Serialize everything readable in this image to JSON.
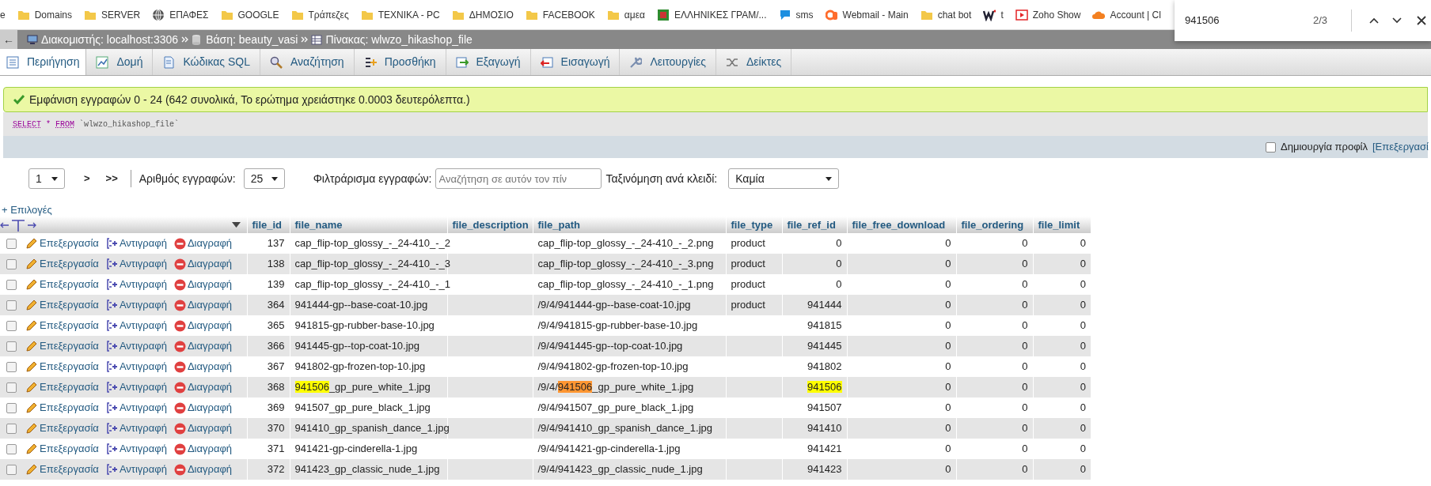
{
  "bookmarks": [
    {
      "label": "e",
      "kind": "page"
    },
    {
      "label": "Domains",
      "kind": "folder"
    },
    {
      "label": "SERVER",
      "kind": "folder"
    },
    {
      "label": "ΕΠΑΦΕΣ",
      "kind": "site"
    },
    {
      "label": "GOOGLE",
      "kind": "folder"
    },
    {
      "label": "Τράπεζες",
      "kind": "folder"
    },
    {
      "label": "ΤΕΧΝΙΚΑ - PC",
      "kind": "folder"
    },
    {
      "label": "ΔΗΜΟΣΙΟ",
      "kind": "folder"
    },
    {
      "label": "FACEBOOK",
      "kind": "folder"
    },
    {
      "label": "αμεα",
      "kind": "folder"
    },
    {
      "label": "ΕΛΛΗΝΙΚΕΣ ΓΡΑΜ/...",
      "kind": "site"
    },
    {
      "label": "sms",
      "kind": "site"
    },
    {
      "label": "Webmail - Main",
      "kind": "site"
    },
    {
      "label": "chat bot",
      "kind": "folder"
    },
    {
      "label": "t",
      "kind": "site"
    },
    {
      "label": "Zoho Show",
      "kind": "site"
    },
    {
      "label": "Account | Cl",
      "kind": "site"
    }
  ],
  "find_bar": {
    "query": "941506",
    "count": "2/3"
  },
  "back_button": "←",
  "breadcrumb": [
    {
      "label": "Διακομιστής: localhost:3306"
    },
    {
      "label": "Βάση: beauty_vasi"
    },
    {
      "label": "Πίνακας: wlwzo_hikashop_file"
    }
  ],
  "tabs": [
    {
      "label": "Περιήγηση",
      "selected": true
    },
    {
      "label": "Δομή",
      "selected": false
    },
    {
      "label": "Κώδικας SQL",
      "selected": false
    },
    {
      "label": "Αναζήτηση",
      "selected": false
    },
    {
      "label": "Προσθήκη",
      "selected": false
    },
    {
      "label": "Εξαγωγή",
      "selected": false
    },
    {
      "label": "Εισαγωγή",
      "selected": false
    },
    {
      "label": "Λειτουργίες",
      "selected": false
    },
    {
      "label": "Δείκτες",
      "selected": false
    }
  ],
  "message": "Εμφάνιση εγγραφών 0 - 24 (642 συνολικά, Το ερώτημα χρειάστηκε 0.0003 δευτερόλεπτα.)",
  "sql": [
    {
      "text": "SELECT",
      "kind": "keyword"
    },
    {
      "text": "*",
      "kind": "operator"
    },
    {
      "text": "FROM",
      "kind": "keyword"
    },
    {
      "text": "`wlwzo_hikashop_file`",
      "kind": "identifier"
    }
  ],
  "profiling": {
    "label": "Δημιουργία προφίλ",
    "checked": false,
    "link": "[Επεξεργασί"
  },
  "navigation": {
    "page": "1",
    "next": ">",
    "last": ">>",
    "rows_label": "Αριθμός εγγραφών:",
    "rows_value": "25",
    "filter_label": "Φιλτράρισμα εγγραφών:",
    "filter_placeholder": "Αναζήτηση σε αυτόν τον πίν",
    "sort_label": "Ταξινόμηση ανά κλειδί:",
    "sort_value": "Καμία"
  },
  "options_link": "+ Επιλογές",
  "table": {
    "columns": [
      "file_id",
      "file_name",
      "file_description",
      "file_path",
      "file_type",
      "file_ref_id",
      "file_free_download",
      "file_ordering",
      "file_limit"
    ],
    "rows": [
      {
        "checked": false,
        "edit": "Επεξεργασία",
        "copy": "Αντιγραφή",
        "delete": "Διαγραφή",
        "file_id": "137",
        "file_name": "cap_flip-top_glossy_-_24-410_-_2",
        "file_path": "cap_flip-top_glossy_-_24-410_-_2.png",
        "file_type": "product",
        "file_ref_id": "0",
        "file_free_download": "0",
        "file_ordering": "0",
        "file_limit": "0"
      },
      {
        "checked": false,
        "edit": "Επεξεργασία",
        "copy": "Αντιγραφή",
        "delete": "Διαγραφή",
        "file_id": "138",
        "file_name": "cap_flip-top_glossy_-_24-410_-_3",
        "file_path": "cap_flip-top_glossy_-_24-410_-_3.png",
        "file_type": "product",
        "file_ref_id": "0",
        "file_free_download": "0",
        "file_ordering": "0",
        "file_limit": "0"
      },
      {
        "checked": false,
        "edit": "Επεξεργασία",
        "copy": "Αντιγραφή",
        "delete": "Διαγραφή",
        "file_id": "139",
        "file_name": "cap_flip-top_glossy_-_24-410_-_1",
        "file_path": "cap_flip-top_glossy_-_24-410_-_1.png",
        "file_type": "product",
        "file_ref_id": "0",
        "file_free_download": "0",
        "file_ordering": "0",
        "file_limit": "0"
      },
      {
        "checked": false,
        "edit": "Επεξεργασία",
        "copy": "Αντιγραφή",
        "delete": "Διαγραφή",
        "file_id": "364",
        "file_name": "941444-gp--base-coat-10.jpg",
        "file_path": "/9/4/941444-gp--base-coat-10.jpg",
        "file_type": "product",
        "file_ref_id": "941444",
        "file_free_download": "0",
        "file_ordering": "0",
        "file_limit": "0"
      },
      {
        "checked": false,
        "edit": "Επεξεργασία",
        "copy": "Αντιγραφή",
        "delete": "Διαγραφή",
        "file_id": "365",
        "file_name": "941815-gp-rubber-base-10.jpg",
        "file_path": "/9/4/941815-gp-rubber-base-10.jpg",
        "file_ref_id": "941815",
        "file_free_download": "0",
        "file_ordering": "0",
        "file_limit": "0"
      },
      {
        "checked": false,
        "edit": "Επεξεργασία",
        "copy": "Αντιγραφή",
        "delete": "Διαγραφή",
        "file_id": "366",
        "file_name": "941445-gp--top-coat-10.jpg",
        "file_path": "/9/4/941445-gp--top-coat-10.jpg",
        "file_ref_id": "941445",
        "file_free_download": "0",
        "file_ordering": "0",
        "file_limit": "0"
      },
      {
        "checked": false,
        "edit": "Επεξεργασία",
        "copy": "Αντιγραφή",
        "delete": "Διαγραφή",
        "file_id": "367",
        "file_name": "941802-gp-frozen-top-10.jpg",
        "file_path": "/9/4/941802-gp-frozen-top-10.jpg",
        "file_ref_id": "941802",
        "file_free_download": "0",
        "file_ordering": "0",
        "file_limit": "0"
      },
      {
        "checked": false,
        "edit": "Επεξεργασία",
        "copy": "Αντιγραφή",
        "delete": "Διαγραφή",
        "file_id": "368",
        "file_name": [
          {
            "text": "941506",
            "match": true,
            "current": false
          },
          {
            "text": "_gp_pure_white_1.jpg",
            "match": false
          }
        ],
        "file_path": [
          {
            "text": "/9/4/",
            "match": false
          },
          {
            "text": "941506",
            "match": true,
            "current": true
          },
          {
            "text": "_gp_pure_white_1.jpg",
            "match": false
          }
        ],
        "file_ref_id": [
          {
            "text": "941506",
            "match": true,
            "current": false
          }
        ],
        "file_free_download": "0",
        "file_ordering": "0",
        "file_limit": "0"
      },
      {
        "checked": false,
        "edit": "Επεξεργασία",
        "copy": "Αντιγραφή",
        "delete": "Διαγραφή",
        "file_id": "369",
        "file_name": "941507_gp_pure_black_1.jpg",
        "file_path": "/9/4/941507_gp_pure_black_1.jpg",
        "file_ref_id": "941507",
        "file_free_download": "0",
        "file_ordering": "0",
        "file_limit": "0"
      },
      {
        "checked": false,
        "edit": "Επεξεργασία",
        "copy": "Αντιγραφή",
        "delete": "Διαγραφή",
        "file_id": "370",
        "file_name": "941410_gp_spanish_dance_1.jpg",
        "file_path": "/9/4/941410_gp_spanish_dance_1.jpg",
        "file_ref_id": "941410",
        "file_free_download": "0",
        "file_ordering": "0",
        "file_limit": "0"
      },
      {
        "checked": false,
        "edit": "Επεξεργασία",
        "copy": "Αντιγραφή",
        "delete": "Διαγραφή",
        "file_id": "371",
        "file_name": "941421-gp-cinderella-1.jpg",
        "file_path": "/9/4/941421-gp-cinderella-1.jpg",
        "file_ref_id": "941421",
        "file_free_download": "0",
        "file_ordering": "0",
        "file_limit": "0"
      },
      {
        "checked": false,
        "edit": "Επεξεργασία",
        "copy": "Αντιγραφή",
        "delete": "Διαγραφή",
        "file_id": "372",
        "file_name": "941423_gp_classic_nude_1.jpg",
        "file_path": "/9/4/941423_gp_classic_nude_1.jpg",
        "file_ref_id": "941423",
        "file_free_download": "0",
        "file_ordering": "0",
        "file_limit": "0"
      }
    ]
  }
}
